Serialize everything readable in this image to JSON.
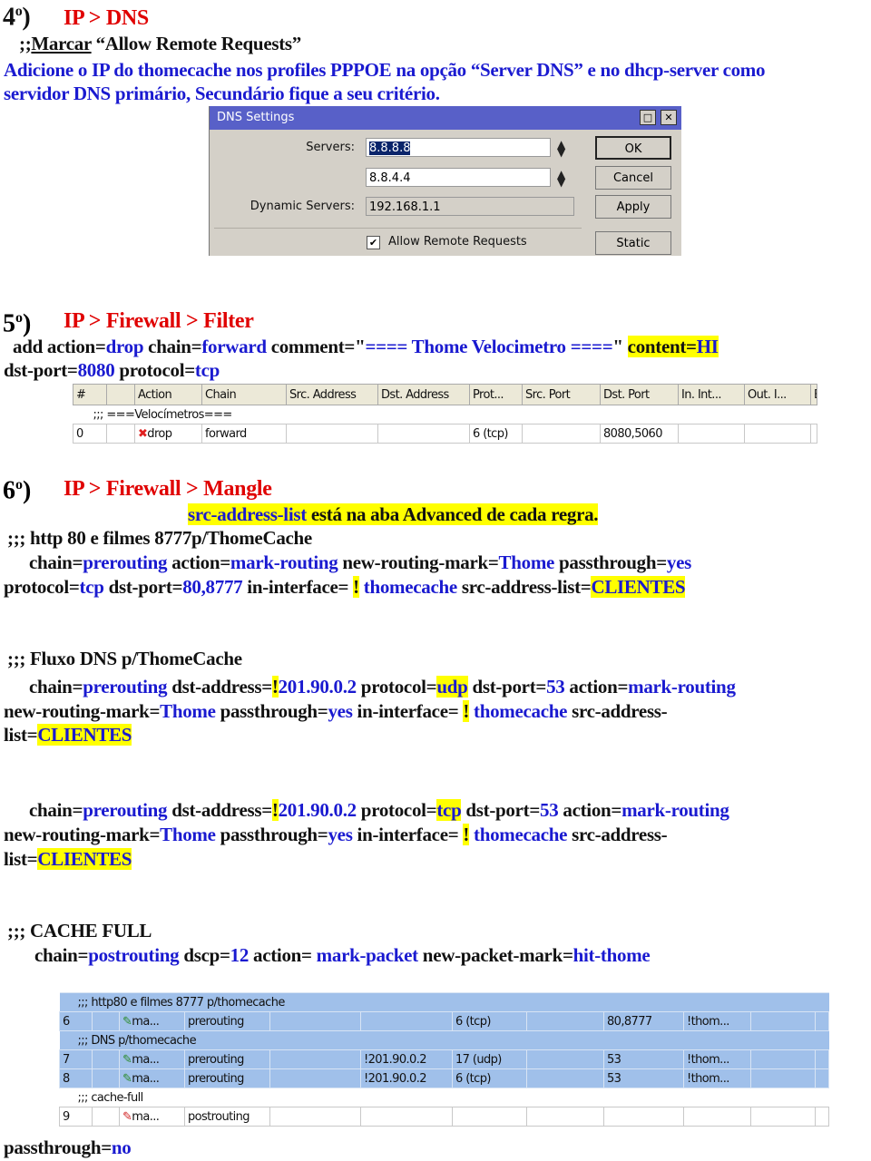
{
  "doc": {
    "lines": [
      [
        [
          "r",
          "IP > DNS"
        ]
      ],
      [
        [
          "b",
          ";;"
        ],
        [
          "b",
          "Marcar"
        ],
        [
          "b",
          " “Allow Remote Requests”"
        ]
      ],
      [
        [
          "u",
          "Adicione o IP do thomecache nos profiles PPPOE na opção “Server DNS” e no dhcp-server como"
        ]
      ],
      [
        [
          "u",
          "servidor DNS primário, Secundário fique a seu critério."
        ]
      ],
      [
        [
          "r",
          "IP > Firewall > Filter"
        ]
      ],
      [
        [
          "b",
          " add action="
        ],
        [
          "u",
          "drop"
        ],
        [
          "b",
          " chain="
        ],
        [
          "u",
          "forward"
        ],
        [
          "b",
          " comment=\""
        ],
        [
          "u",
          "==== Thome Velocimetro ===="
        ],
        [
          "b",
          "\" "
        ],
        [
          "h",
          "content="
        ],
        [
          "hu",
          "HI"
        ]
      ],
      [
        [
          "b",
          "dst-port="
        ],
        [
          "u",
          "8080"
        ],
        [
          "b",
          " protocol="
        ],
        [
          "u",
          "tcp"
        ]
      ],
      [
        [
          "r",
          "IP > Firewall > Mangle"
        ]
      ],
      [
        [
          "hu",
          "src-address-list"
        ],
        [
          "h",
          " está na aba Advanced de cada regra."
        ]
      ],
      [
        [
          "b",
          ";;; http 80 e filmes 8777p/ThomeCache"
        ]
      ],
      [
        [
          "b",
          "chain="
        ],
        [
          "u",
          "prerouting"
        ],
        [
          "b",
          "  action="
        ],
        [
          "u",
          "mark-routing"
        ],
        [
          "b",
          "  new-routing-mark="
        ],
        [
          "u",
          "Thome"
        ],
        [
          "b",
          "  passthrough="
        ],
        [
          "u",
          "yes"
        ]
      ],
      [
        [
          "b",
          "protocol="
        ],
        [
          "u",
          "tcp"
        ],
        [
          "b",
          "  dst-port="
        ],
        [
          "u",
          "80,8777"
        ],
        [
          "b",
          "  in-interface= "
        ],
        [
          "h",
          "!"
        ],
        [
          "b",
          " "
        ],
        [
          "u",
          "thomecache"
        ],
        [
          "b",
          " src-address-list="
        ],
        [
          "hu",
          "CLIENTES"
        ]
      ],
      [
        [
          "b",
          ";;; Fluxo DNS  p/ThomeCache"
        ]
      ],
      [
        [
          "b",
          "chain="
        ],
        [
          "u",
          "prerouting"
        ],
        [
          "b",
          "  dst-address="
        ],
        [
          "h",
          "!"
        ],
        [
          "u",
          "201.90.0.2"
        ],
        [
          "b",
          " protocol="
        ],
        [
          "hu",
          "udp"
        ],
        [
          "b",
          "  dst-port="
        ],
        [
          "u",
          "53"
        ],
        [
          "b",
          " action="
        ],
        [
          "u",
          "mark-routing"
        ]
      ],
      [
        [
          "b",
          "new-routing-mark="
        ],
        [
          "u",
          "Thome"
        ],
        [
          "b",
          "  passthrough="
        ],
        [
          "u",
          "yes"
        ],
        [
          "b",
          "  in-interface= "
        ],
        [
          "h",
          "!"
        ],
        [
          "b",
          " "
        ],
        [
          "u",
          "thomecache"
        ],
        [
          "b",
          " src-address-"
        ]
      ],
      [
        [
          "b",
          "list="
        ],
        [
          "hu",
          "CLIENTES"
        ]
      ],
      [
        [
          "b",
          "chain="
        ],
        [
          "u",
          "prerouting"
        ],
        [
          "b",
          "  dst-address="
        ],
        [
          "h",
          "!"
        ],
        [
          "u",
          "201.90.0.2"
        ],
        [
          "b",
          " protocol="
        ],
        [
          "hu",
          "tcp"
        ],
        [
          "b",
          "  dst-port="
        ],
        [
          "u",
          "53"
        ],
        [
          "b",
          " action="
        ],
        [
          "u",
          "mark-routing"
        ]
      ],
      [
        [
          "b",
          "new-routing-mark="
        ],
        [
          "u",
          "Thome"
        ],
        [
          "b",
          "  passthrough="
        ],
        [
          "u",
          "yes"
        ],
        [
          "b",
          "  in-interface= "
        ],
        [
          "h",
          "!"
        ],
        [
          "b",
          " "
        ],
        [
          "u",
          "thomecache"
        ],
        [
          "b",
          " src-address-"
        ]
      ],
      [
        [
          "b",
          "list="
        ],
        [
          "hu",
          "CLIENTES"
        ]
      ],
      [
        [
          "b",
          ";;; CACHE FULL"
        ]
      ],
      [
        [
          "b",
          "chain="
        ],
        [
          "u",
          "postrouting"
        ],
        [
          "b",
          " dscp="
        ],
        [
          "u",
          "12"
        ],
        [
          "b",
          "  action= "
        ],
        [
          "u",
          "mark-packet"
        ],
        [
          "b",
          "  new-packet-mark="
        ],
        [
          "u",
          "hit-thome"
        ]
      ],
      [
        [
          "b",
          "passthrough="
        ],
        [
          "u",
          "no"
        ]
      ]
    ],
    "step_numbers": [
      "4",
      "5",
      "6"
    ],
    "ordinal": "o",
    "step_suffix": ")"
  },
  "dns_dialog": {
    "title": "DNS Settings",
    "servers_label": "Servers:",
    "server1": "8.8.8.8",
    "server2": "8.8.4.4",
    "dynamic_label": "Dynamic Servers:",
    "dynamic_value": "192.168.1.1",
    "allow_remote_label": "Allow Remote Requests",
    "allow_remote_checked": true,
    "buttons": {
      "ok": "OK",
      "cancel": "Cancel",
      "apply": "Apply",
      "static": "Static"
    }
  },
  "filter_table": {
    "headers": [
      "#",
      "",
      "Action",
      "Chain",
      "Src. Address",
      "Dst. Address",
      "Prot...",
      "Src. Port",
      "Dst. Port",
      "In. Int...",
      "Out. I...",
      "B"
    ],
    "comment": ";;; ===Velocímetros===",
    "row": [
      "0",
      "",
      "drop",
      "forward",
      "",
      "",
      "6 (tcp)",
      "",
      "8080,5060",
      "",
      "",
      ""
    ]
  },
  "mangle_table": {
    "rows": [
      {
        "type": "comment",
        "text": ";;; http80 e filmes 8777 p/thomecache",
        "selected": true
      },
      {
        "type": "row",
        "cells": [
          "6",
          "",
          "ma...",
          "prerouting",
          "",
          "",
          "6 (tcp)",
          "",
          "80,8777",
          "!thom...",
          "",
          ""
        ],
        "selected": true
      },
      {
        "type": "comment",
        "text": ";;; DNS p/thomecache",
        "selected": true
      },
      {
        "type": "row",
        "cells": [
          "7",
          "",
          "ma...",
          "prerouting",
          "",
          "!201.90.0.2",
          "17 (udp)",
          "",
          "53",
          "!thom...",
          "",
          ""
        ],
        "selected": true
      },
      {
        "type": "row",
        "cells": [
          "8",
          "",
          "ma...",
          "prerouting",
          "",
          "!201.90.0.2",
          "6 (tcp)",
          "",
          "53",
          "!thom...",
          "",
          ""
        ],
        "selected": true
      },
      {
        "type": "comment",
        "text": ";;; cache-full",
        "selected": false
      },
      {
        "type": "row",
        "cells": [
          "9",
          "",
          "ma...",
          "postrouting",
          "",
          "",
          "",
          "",
          "",
          "",
          "",
          ""
        ],
        "selected": false
      }
    ]
  },
  "colors": {
    "blue_text": "#1a1ad0",
    "red_heading": "#e00000",
    "highlight": "#ffff00",
    "selected_row": "#a0c0ea"
  }
}
